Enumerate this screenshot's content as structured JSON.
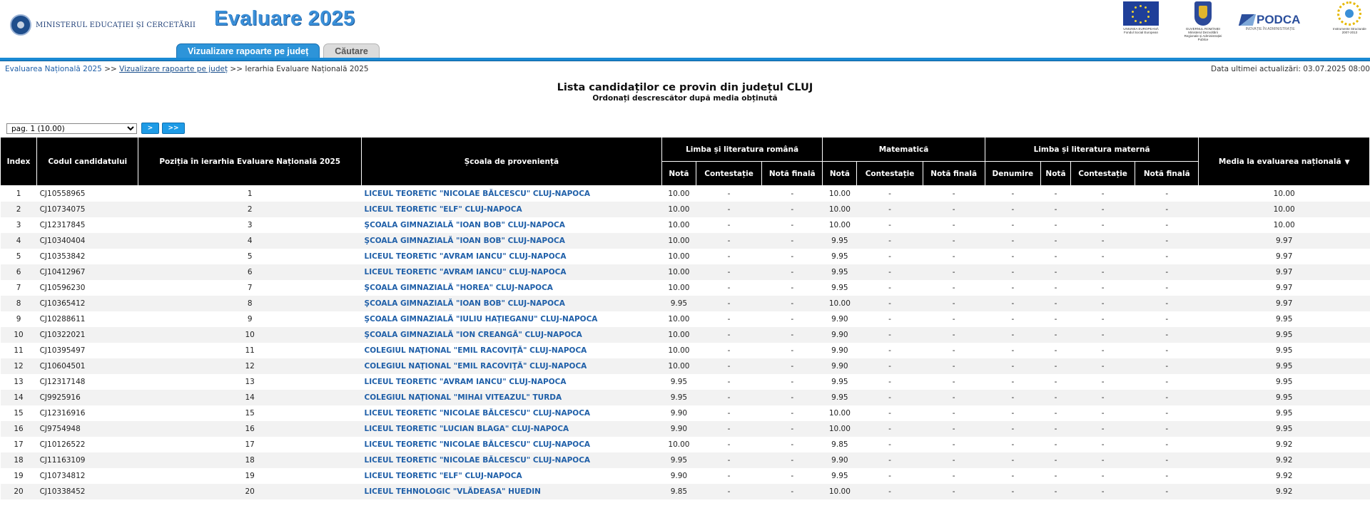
{
  "header": {
    "ministry_name": "MINISTERUL EDUCAȚIEI ȘI CERCETĂRII",
    "app_title": "Evaluare 2025",
    "tabs": [
      {
        "label": "Vizualizare rapoarte pe județ",
        "active": true
      },
      {
        "label": "Căutare",
        "active": false
      }
    ],
    "partner_logos": [
      "eu-flag",
      "romanian-government-crest",
      "podca-logo",
      "structural-instruments-logo"
    ],
    "partners": {
      "eu": "UNIUNEA EUROPEANĂ",
      "eu_sub": "Fondul Social European",
      "gov": "GUVERNUL ROMÂNIEI",
      "gov_sub": "Ministerul Dezvoltării Regionale și Administrației Publice",
      "podca": "PODCA",
      "podca_sub": "INOVAȚIE ÎN ADMINISTRAȚIE",
      "structural": "Instrumente Structurale",
      "structural_years": "2007-2013"
    },
    "accent_color": "#1a8ad4"
  },
  "breadcrumb": {
    "items": [
      "Evaluarea Națională 2025",
      "Vizualizare rapoarte pe județ",
      "Ierarhia Evaluare Națională 2025"
    ],
    "separator": ">>"
  },
  "last_update": "Data ultimei actualizări: 03.07.2025 08:00",
  "title": "Lista candidaților ce provin din județul CLUJ",
  "subtitle": "Ordonați descrescător după media obținută",
  "pager": {
    "selected": "pag. 1 (10.00)",
    "next_label": ">",
    "last_label": ">>"
  },
  "table": {
    "headers": {
      "index": "Index",
      "code": "Codul candidatului",
      "position": "Poziția în ierarhia Evaluare Națională 2025",
      "school": "Școala de proveniență",
      "romanian": "Limba și literatura română",
      "math": "Matematică",
      "mother": "Limba și literatura maternă",
      "average": "Media la evaluarea națională",
      "nota": "Notă",
      "contestatie": "Contestație",
      "nota_finala": "Notă finală",
      "denumire": "Denumire"
    },
    "rows": [
      {
        "index": "1",
        "code": "CJ10558965",
        "pos": "1",
        "school": "LICEUL TEORETIC \"NICOLAE BĂLCESCU\" CLUJ-NAPOCA",
        "ro": "10.00",
        "ro_c": "-",
        "ro_f": "-",
        "ma": "10.00",
        "ma_c": "-",
        "ma_f": "-",
        "lm_d": "-",
        "lm_n": "-",
        "lm_c": "-",
        "lm_f": "-",
        "avg": "10.00"
      },
      {
        "index": "2",
        "code": "CJ10734075",
        "pos": "2",
        "school": "LICEUL TEORETIC \"ELF\" CLUJ-NAPOCA",
        "ro": "10.00",
        "ro_c": "-",
        "ro_f": "-",
        "ma": "10.00",
        "ma_c": "-",
        "ma_f": "-",
        "lm_d": "-",
        "lm_n": "-",
        "lm_c": "-",
        "lm_f": "-",
        "avg": "10.00"
      },
      {
        "index": "3",
        "code": "CJ12317845",
        "pos": "3",
        "school": "ŞCOALA GIMNAZIALĂ \"IOAN BOB\" CLUJ-NAPOCA",
        "ro": "10.00",
        "ro_c": "-",
        "ro_f": "-",
        "ma": "10.00",
        "ma_c": "-",
        "ma_f": "-",
        "lm_d": "-",
        "lm_n": "-",
        "lm_c": "-",
        "lm_f": "-",
        "avg": "10.00"
      },
      {
        "index": "4",
        "code": "CJ10340404",
        "pos": "4",
        "school": "ŞCOALA GIMNAZIALĂ \"IOAN BOB\" CLUJ-NAPOCA",
        "ro": "10.00",
        "ro_c": "-",
        "ro_f": "-",
        "ma": "9.95",
        "ma_c": "-",
        "ma_f": "-",
        "lm_d": "-",
        "lm_n": "-",
        "lm_c": "-",
        "lm_f": "-",
        "avg": "9.97"
      },
      {
        "index": "5",
        "code": "CJ10353842",
        "pos": "5",
        "school": "LICEUL TEORETIC \"AVRAM IANCU\" CLUJ-NAPOCA",
        "ro": "10.00",
        "ro_c": "-",
        "ro_f": "-",
        "ma": "9.95",
        "ma_c": "-",
        "ma_f": "-",
        "lm_d": "-",
        "lm_n": "-",
        "lm_c": "-",
        "lm_f": "-",
        "avg": "9.97"
      },
      {
        "index": "6",
        "code": "CJ10412967",
        "pos": "6",
        "school": "LICEUL TEORETIC \"AVRAM IANCU\" CLUJ-NAPOCA",
        "ro": "10.00",
        "ro_c": "-",
        "ro_f": "-",
        "ma": "9.95",
        "ma_c": "-",
        "ma_f": "-",
        "lm_d": "-",
        "lm_n": "-",
        "lm_c": "-",
        "lm_f": "-",
        "avg": "9.97"
      },
      {
        "index": "7",
        "code": "CJ10596230",
        "pos": "7",
        "school": "ŞCOALA GIMNAZIALĂ \"HOREA\" CLUJ-NAPOCA",
        "ro": "10.00",
        "ro_c": "-",
        "ro_f": "-",
        "ma": "9.95",
        "ma_c": "-",
        "ma_f": "-",
        "lm_d": "-",
        "lm_n": "-",
        "lm_c": "-",
        "lm_f": "-",
        "avg": "9.97"
      },
      {
        "index": "8",
        "code": "CJ10365412",
        "pos": "8",
        "school": "ŞCOALA GIMNAZIALĂ \"IOAN BOB\" CLUJ-NAPOCA",
        "ro": "9.95",
        "ro_c": "-",
        "ro_f": "-",
        "ma": "10.00",
        "ma_c": "-",
        "ma_f": "-",
        "lm_d": "-",
        "lm_n": "-",
        "lm_c": "-",
        "lm_f": "-",
        "avg": "9.97"
      },
      {
        "index": "9",
        "code": "CJ10288611",
        "pos": "9",
        "school": "ŞCOALA GIMNAZIALĂ \"IULIU HAŢIEGANU\" CLUJ-NAPOCA",
        "ro": "10.00",
        "ro_c": "-",
        "ro_f": "-",
        "ma": "9.90",
        "ma_c": "-",
        "ma_f": "-",
        "lm_d": "-",
        "lm_n": "-",
        "lm_c": "-",
        "lm_f": "-",
        "avg": "9.95"
      },
      {
        "index": "10",
        "code": "CJ10322021",
        "pos": "10",
        "school": "ŞCOALA GIMNAZIALĂ \"ION CREANGĂ\" CLUJ-NAPOCA",
        "ro": "10.00",
        "ro_c": "-",
        "ro_f": "-",
        "ma": "9.90",
        "ma_c": "-",
        "ma_f": "-",
        "lm_d": "-",
        "lm_n": "-",
        "lm_c": "-",
        "lm_f": "-",
        "avg": "9.95"
      },
      {
        "index": "11",
        "code": "CJ10395497",
        "pos": "11",
        "school": "COLEGIUL NAŢIONAL \"EMIL RACOVIŢĂ\" CLUJ-NAPOCA",
        "ro": "10.00",
        "ro_c": "-",
        "ro_f": "-",
        "ma": "9.90",
        "ma_c": "-",
        "ma_f": "-",
        "lm_d": "-",
        "lm_n": "-",
        "lm_c": "-",
        "lm_f": "-",
        "avg": "9.95"
      },
      {
        "index": "12",
        "code": "CJ10604501",
        "pos": "12",
        "school": "COLEGIUL NAŢIONAL \"EMIL RACOVIŢĂ\" CLUJ-NAPOCA",
        "ro": "10.00",
        "ro_c": "-",
        "ro_f": "-",
        "ma": "9.90",
        "ma_c": "-",
        "ma_f": "-",
        "lm_d": "-",
        "lm_n": "-",
        "lm_c": "-",
        "lm_f": "-",
        "avg": "9.95"
      },
      {
        "index": "13",
        "code": "CJ12317148",
        "pos": "13",
        "school": "LICEUL TEORETIC \"AVRAM IANCU\" CLUJ-NAPOCA",
        "ro": "9.95",
        "ro_c": "-",
        "ro_f": "-",
        "ma": "9.95",
        "ma_c": "-",
        "ma_f": "-",
        "lm_d": "-",
        "lm_n": "-",
        "lm_c": "-",
        "lm_f": "-",
        "avg": "9.95"
      },
      {
        "index": "14",
        "code": "CJ9925916",
        "pos": "14",
        "school": "COLEGIUL NAŢIONAL \"MIHAI VITEAZUL\" TURDA",
        "ro": "9.95",
        "ro_c": "-",
        "ro_f": "-",
        "ma": "9.95",
        "ma_c": "-",
        "ma_f": "-",
        "lm_d": "-",
        "lm_n": "-",
        "lm_c": "-",
        "lm_f": "-",
        "avg": "9.95"
      },
      {
        "index": "15",
        "code": "CJ12316916",
        "pos": "15",
        "school": "LICEUL TEORETIC \"NICOLAE BĂLCESCU\" CLUJ-NAPOCA",
        "ro": "9.90",
        "ro_c": "-",
        "ro_f": "-",
        "ma": "10.00",
        "ma_c": "-",
        "ma_f": "-",
        "lm_d": "-",
        "lm_n": "-",
        "lm_c": "-",
        "lm_f": "-",
        "avg": "9.95"
      },
      {
        "index": "16",
        "code": "CJ9754948",
        "pos": "16",
        "school": "LICEUL TEORETIC \"LUCIAN BLAGA\" CLUJ-NAPOCA",
        "ro": "9.90",
        "ro_c": "-",
        "ro_f": "-",
        "ma": "10.00",
        "ma_c": "-",
        "ma_f": "-",
        "lm_d": "-",
        "lm_n": "-",
        "lm_c": "-",
        "lm_f": "-",
        "avg": "9.95"
      },
      {
        "index": "17",
        "code": "CJ10126522",
        "pos": "17",
        "school": "LICEUL TEORETIC \"NICOLAE BĂLCESCU\" CLUJ-NAPOCA",
        "ro": "10.00",
        "ro_c": "-",
        "ro_f": "-",
        "ma": "9.85",
        "ma_c": "-",
        "ma_f": "-",
        "lm_d": "-",
        "lm_n": "-",
        "lm_c": "-",
        "lm_f": "-",
        "avg": "9.92"
      },
      {
        "index": "18",
        "code": "CJ11163109",
        "pos": "18",
        "school": "LICEUL TEORETIC \"NICOLAE BĂLCESCU\" CLUJ-NAPOCA",
        "ro": "9.95",
        "ro_c": "-",
        "ro_f": "-",
        "ma": "9.90",
        "ma_c": "-",
        "ma_f": "-",
        "lm_d": "-",
        "lm_n": "-",
        "lm_c": "-",
        "lm_f": "-",
        "avg": "9.92"
      },
      {
        "index": "19",
        "code": "CJ10734812",
        "pos": "19",
        "school": "LICEUL TEORETIC \"ELF\" CLUJ-NAPOCA",
        "ro": "9.90",
        "ro_c": "-",
        "ro_f": "-",
        "ma": "9.95",
        "ma_c": "-",
        "ma_f": "-",
        "lm_d": "-",
        "lm_n": "-",
        "lm_c": "-",
        "lm_f": "-",
        "avg": "9.92"
      },
      {
        "index": "20",
        "code": "CJ10338452",
        "pos": "20",
        "school": "LICEUL TEHNOLOGIC \"VLĂDEASA\" HUEDIN",
        "ro": "9.85",
        "ro_c": "-",
        "ro_f": "-",
        "ma": "10.00",
        "ma_c": "-",
        "ma_f": "-",
        "lm_d": "-",
        "lm_n": "-",
        "lm_c": "-",
        "lm_f": "-",
        "avg": "9.92"
      }
    ]
  }
}
